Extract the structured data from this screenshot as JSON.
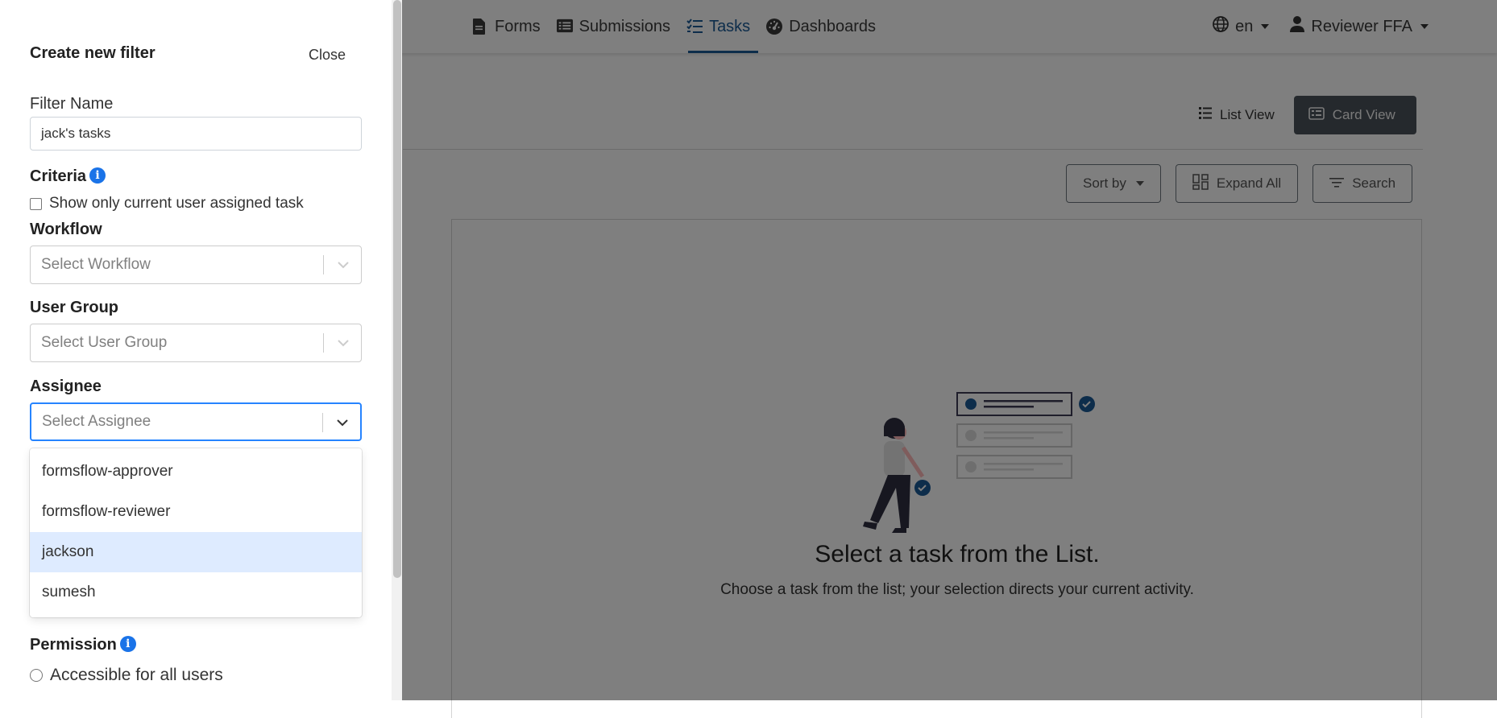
{
  "nav": {
    "links": [
      {
        "label": "Forms",
        "icon": "file-icon"
      },
      {
        "label": "Submissions",
        "icon": "list-alt-icon"
      },
      {
        "label": "Tasks",
        "icon": "tasks-icon",
        "active": true
      },
      {
        "label": "Dashboards",
        "icon": "tachometer-icon"
      }
    ],
    "language": "en",
    "user": "Reviewer FFA"
  },
  "view_toggle": {
    "list_label": "List View",
    "card_label": "Card View",
    "active": "Card View"
  },
  "toolbar": {
    "sort_label": "Sort by",
    "expand_label": "Expand All",
    "search_label": "Search"
  },
  "empty_state": {
    "title": "Select a task from the List.",
    "subtitle": "Choose a task from the list; your selection directs your current activity."
  },
  "drawer": {
    "title": "Create new filter",
    "close_label": "Close",
    "filter_name": {
      "label": "Filter Name",
      "value": "jack's tasks"
    },
    "criteria": {
      "label": "Criteria",
      "checkbox_label": "Show only current user assigned task"
    },
    "workflow": {
      "label": "Workflow",
      "placeholder": "Select Workflow"
    },
    "user_group": {
      "label": "User Group",
      "placeholder": "Select User Group"
    },
    "assignee": {
      "label": "Assignee",
      "placeholder": "Select Assignee",
      "options": [
        "formsflow-approver",
        "formsflow-reviewer",
        "jackson",
        "sumesh"
      ],
      "highlighted": "jackson"
    },
    "permission": {
      "label": "Permission",
      "radio_label": "Accessible for all users"
    }
  },
  "colors": {
    "accent": "#1a5a96",
    "focus": "#2684ff",
    "option_highlight": "#deebff",
    "card_view_bg": "#4a525a",
    "info": "#1a73e8"
  }
}
